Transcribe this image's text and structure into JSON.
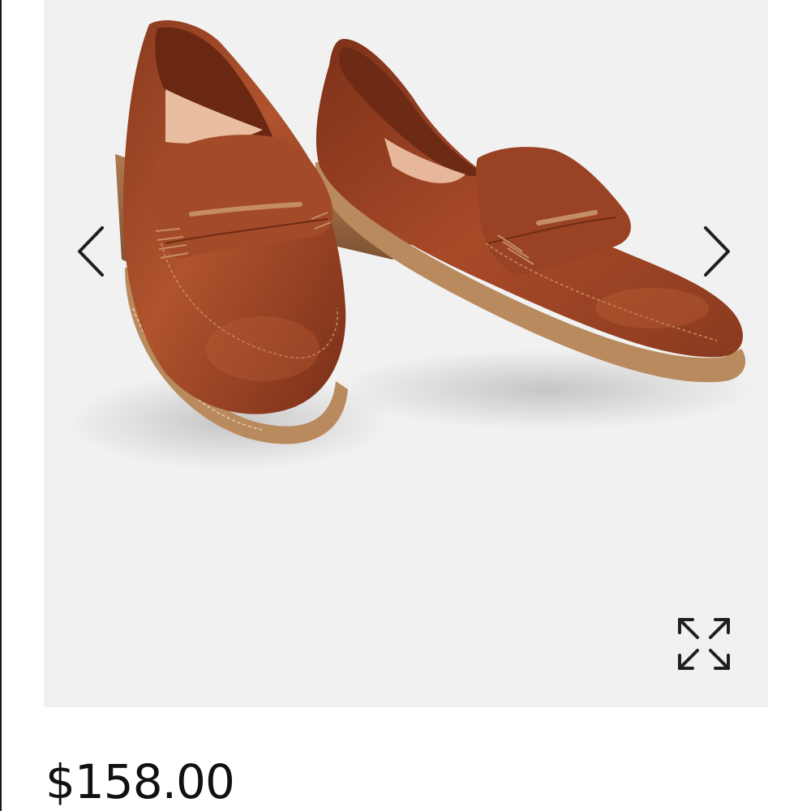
{
  "product": {
    "image_icon": "loafers-product-photo",
    "price": "$158.00"
  },
  "gallery": {
    "prev_icon": "chevron-left-icon",
    "next_icon": "chevron-right-icon",
    "expand_icon": "expand-arrows-icon"
  },
  "colors": {
    "gallery_background": "#f1f1f1",
    "leather": "#a0472a",
    "price_text": "#111111",
    "control": "#1f1f1f"
  }
}
